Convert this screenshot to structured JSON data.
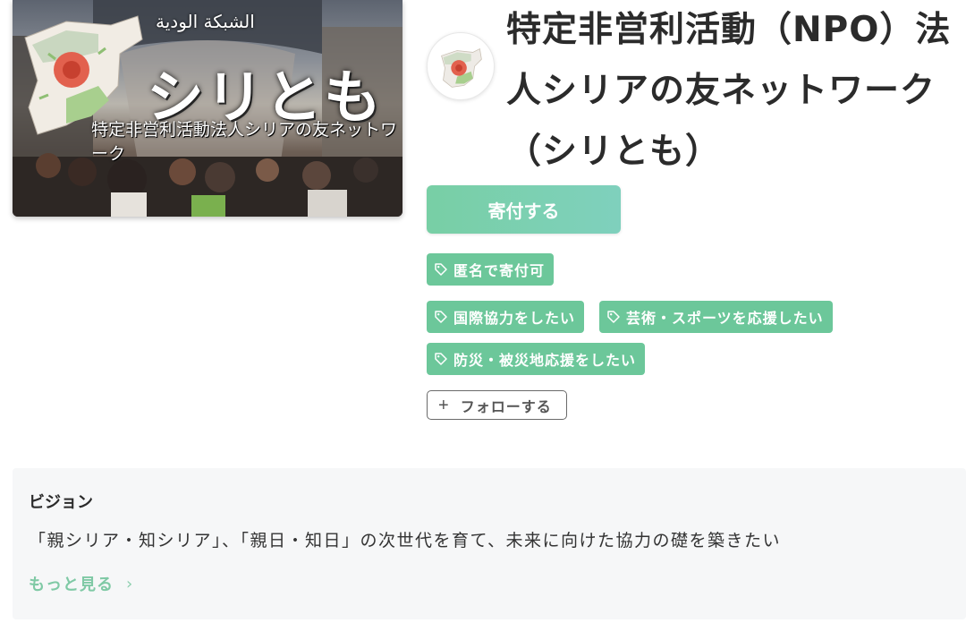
{
  "cover": {
    "arabic_text": "الشبكة الودية",
    "title": "シリとも",
    "subtitle": "特定非営利活動法人シリアの友ネットワーク"
  },
  "organization": {
    "name": "特定非営利活動（NPO）法人シリアの友ネットワーク（シリとも）"
  },
  "actions": {
    "donate_label": "寄付する",
    "follow_label": "フォローする"
  },
  "tags": {
    "anonymous": "匿名で寄付可",
    "international": "国際協力をしたい",
    "arts_sports": "芸術・スポーツを応援したい",
    "disaster": "防災・被災地応援をしたい"
  },
  "vision": {
    "heading": "ビジョン",
    "text": "「親シリア・知シリア」、「親日・知日」の次世代を育て、未来に向けた協力の礎を築きたい",
    "more_label": "もっと見る"
  },
  "colors": {
    "accent_green": "#6cc79a",
    "donate_gradient_start": "#78cfa5",
    "donate_gradient_end": "#7fd0bd",
    "link_green": "#7fc9a5"
  }
}
